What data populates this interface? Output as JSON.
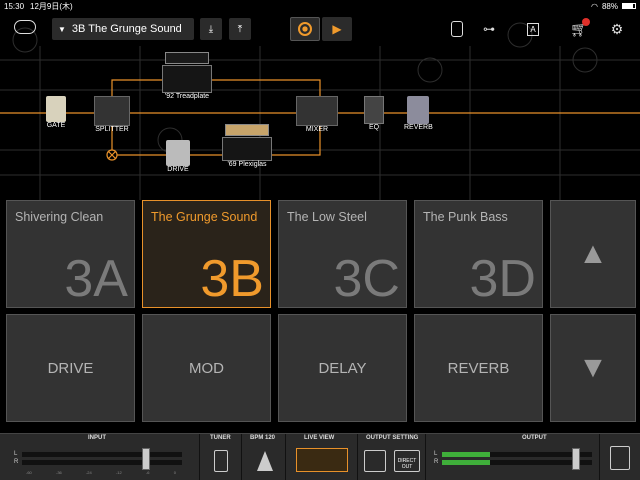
{
  "status": {
    "time": "15:30",
    "date": "12月9日(木)",
    "battery": "88%"
  },
  "header": {
    "preset_name": "3B The Grunge Sound"
  },
  "chain": {
    "nodes": [
      "GATE",
      "SPLITTER",
      "DRIVE",
      "'92 Treadplate",
      "'69 Plexiglas",
      "MIXER",
      "EQ",
      "REVERB"
    ]
  },
  "presets": [
    {
      "name": "Shivering Clean",
      "num": "3A"
    },
    {
      "name": "The Grunge Sound",
      "num": "3B"
    },
    {
      "name": "The Low Steel",
      "num": "3C"
    },
    {
      "name": "The Punk Bass",
      "num": "3D"
    }
  ],
  "effects": [
    "DRIVE",
    "MOD",
    "DELAY",
    "REVERB"
  ],
  "bottom": {
    "input": "INPUT",
    "tuner": "TUNER",
    "bpm": "BPM 120",
    "live_view": "LIVE VIEW",
    "output_setting": "OUTPUT SETTING",
    "output": "OUTPUT",
    "direct_out": "DIRECT OUT",
    "ch_l": "L",
    "ch_r": "R",
    "scale": [
      "-60",
      "-36",
      "-24",
      "-12",
      "-6",
      "0"
    ]
  },
  "colors": {
    "accent": "#f09a2c",
    "route": "#e8912a",
    "badge": "#e0302a"
  }
}
